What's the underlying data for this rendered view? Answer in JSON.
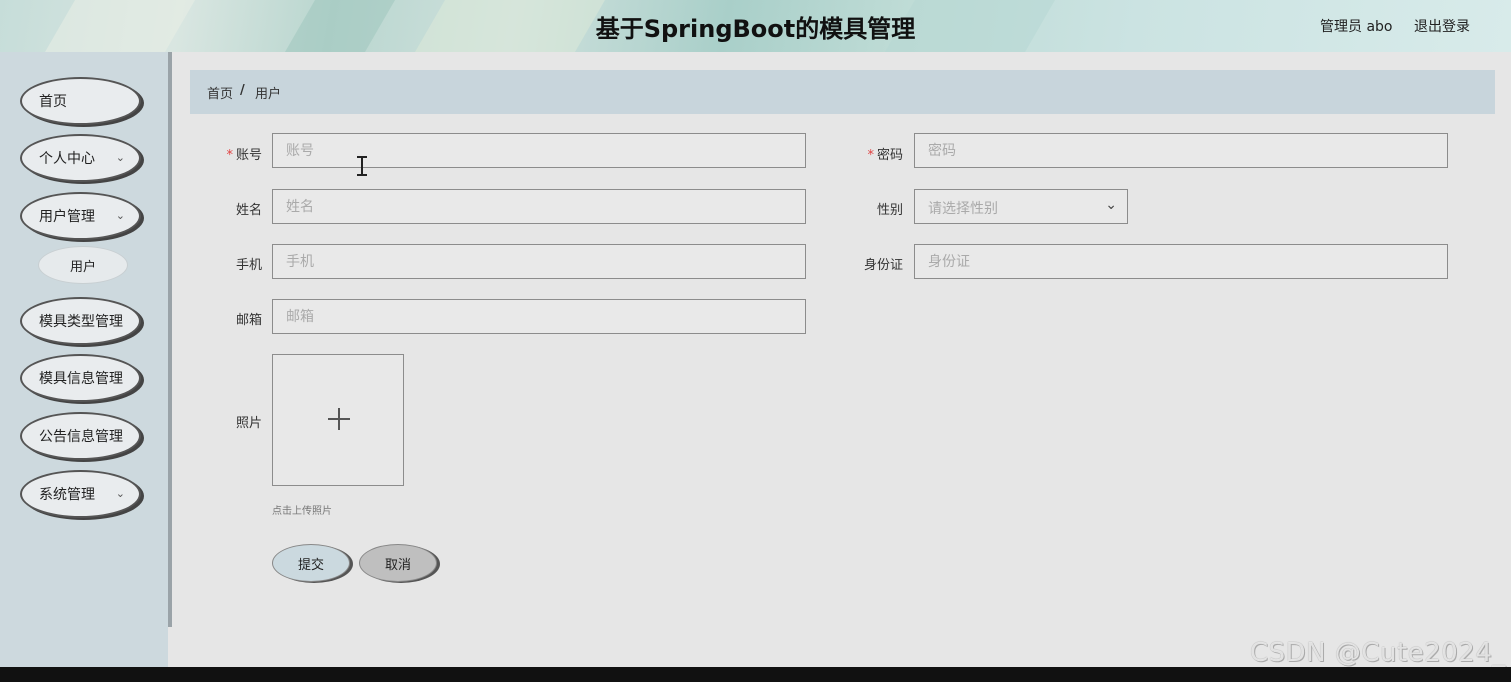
{
  "header": {
    "title": "基于SpringBoot的模具管理",
    "admin_label": "管理员 abo",
    "logout_label": "退出登录"
  },
  "sidebar": {
    "items": [
      {
        "label": "首页",
        "has_chevron": false
      },
      {
        "label": "个人中心",
        "has_chevron": true
      },
      {
        "label": "用户管理",
        "has_chevron": true
      },
      {
        "label": "模具类型管理",
        "has_chevron": true
      },
      {
        "label": "模具信息管理",
        "has_chevron": true
      },
      {
        "label": "公告信息管理",
        "has_chevron": true
      },
      {
        "label": "系统管理",
        "has_chevron": true
      }
    ],
    "sub_item": "用户"
  },
  "breadcrumb": {
    "home": "首页",
    "separator": "/",
    "current": "用户"
  },
  "form": {
    "account": {
      "label": "账号",
      "placeholder": "账号",
      "required": true
    },
    "password": {
      "label": "密码",
      "placeholder": "密码",
      "required": true
    },
    "name": {
      "label": "姓名",
      "placeholder": "姓名"
    },
    "gender": {
      "label": "性别",
      "placeholder": "请选择性别"
    },
    "phone": {
      "label": "手机",
      "placeholder": "手机"
    },
    "id_card": {
      "label": "身份证",
      "placeholder": "身份证"
    },
    "email": {
      "label": "邮箱",
      "placeholder": "邮箱"
    },
    "photo": {
      "label": "照片",
      "hint": "点击上传照片"
    },
    "submit_label": "提交",
    "cancel_label": "取消"
  },
  "icons": {
    "chevron": "chevron-down-icon",
    "upload": "plus-icon"
  },
  "colors": {
    "sidebar_bg": "#cdd9de",
    "breadcrumb_bg": "#c8d5dc",
    "content_bg": "#e6e6e6",
    "required": "#e04040"
  },
  "watermark": "CSDN @Cute2024_"
}
